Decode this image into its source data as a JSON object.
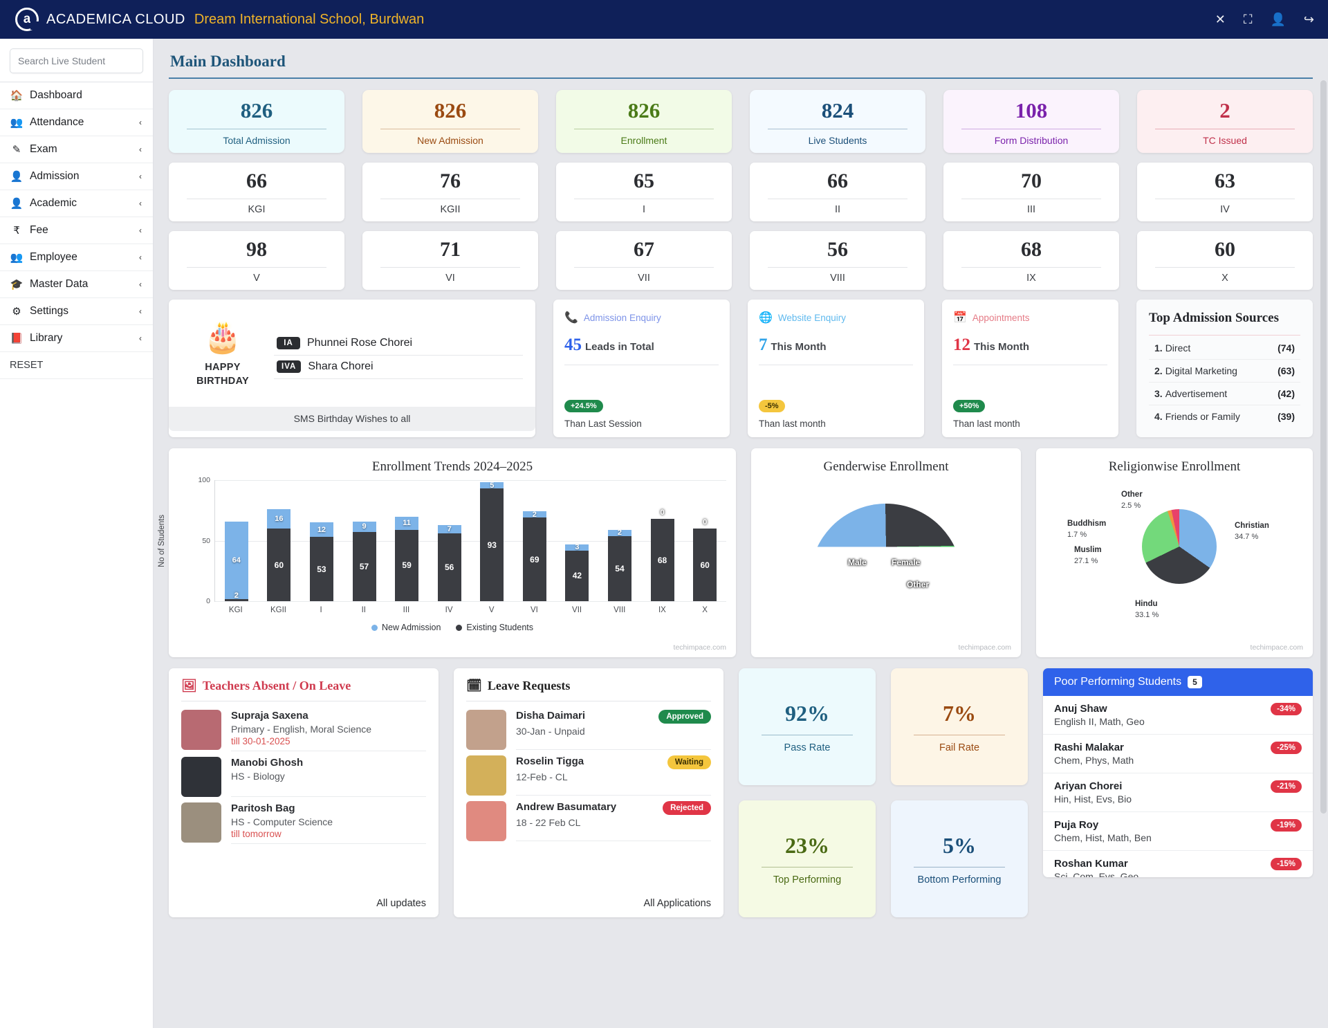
{
  "topbar": {
    "brand": "ACADEMICA CLOUD",
    "school": "Dream International School, Burdwan",
    "close_icon": "✕",
    "expand_icon": "⛶",
    "user_icon": "👤",
    "logout_icon": "↪"
  },
  "sidebar": {
    "search_placeholder": "Search Live Student",
    "items": [
      {
        "label": "Dashboard",
        "icon": "🏠",
        "chevron": ""
      },
      {
        "label": "Attendance",
        "icon": "👥",
        "chevron": "‹"
      },
      {
        "label": "Exam",
        "icon": "✎",
        "chevron": "‹"
      },
      {
        "label": "Admission",
        "icon": "👤",
        "chevron": "‹"
      },
      {
        "label": "Academic",
        "icon": "👤",
        "chevron": "‹"
      },
      {
        "label": "Fee",
        "icon": "₹",
        "chevron": "‹"
      },
      {
        "label": "Employee",
        "icon": "👥",
        "chevron": "‹"
      },
      {
        "label": "Master Data",
        "icon": "🎓",
        "chevron": "‹"
      },
      {
        "label": "Settings",
        "icon": "⚙",
        "chevron": "‹"
      },
      {
        "label": "Library",
        "icon": "📕",
        "chevron": "‹"
      }
    ],
    "reset": "RESET"
  },
  "page": {
    "title": "Main Dashboard"
  },
  "kpis": [
    {
      "value": "826",
      "label": "Total Admission",
      "color": "#1f5f80",
      "bg": "#ecfbfd"
    },
    {
      "value": "826",
      "label": "New Admission",
      "color": "#9a4a11",
      "bg": "#fdf7e8"
    },
    {
      "value": "826",
      "label": "Enrollment",
      "color": "#4a7a17",
      "bg": "#f2fbe7"
    },
    {
      "value": "824",
      "label": "Live Students",
      "color": "#1b4f79",
      "bg": "#f4faff"
    },
    {
      "value": "108",
      "label": "Form Distribution",
      "color": "#7a22ab",
      "bg": "#fbf3fd"
    },
    {
      "value": "2",
      "label": "TC Issued",
      "color": "#c0304a",
      "bg": "#fdeff1"
    }
  ],
  "classes": [
    {
      "value": "66",
      "label": "KGI"
    },
    {
      "value": "76",
      "label": "KGII"
    },
    {
      "value": "65",
      "label": "I"
    },
    {
      "value": "66",
      "label": "II"
    },
    {
      "value": "70",
      "label": "III"
    },
    {
      "value": "63",
      "label": "IV"
    },
    {
      "value": "98",
      "label": "V"
    },
    {
      "value": "71",
      "label": "VI"
    },
    {
      "value": "67",
      "label": "VII"
    },
    {
      "value": "56",
      "label": "VIII"
    },
    {
      "value": "68",
      "label": "IX"
    },
    {
      "value": "60",
      "label": "X"
    }
  ],
  "birthday": {
    "cake_icon": "🎂",
    "title": "HAPPY BIRTHDAY",
    "people": [
      {
        "class": "IA",
        "name": "Phunnei Rose Chorei"
      },
      {
        "class": "IVA",
        "name": "Shara Chorei"
      }
    ],
    "footer": "SMS Birthday Wishes to all"
  },
  "enquiries": [
    {
      "icon": "📞",
      "title": "Admission Enquiry",
      "title_color": "#7d93e8",
      "number": "45",
      "number_color": "#2f62ea",
      "text": "Leads in Total",
      "badge": "+24.5%",
      "badge_color": "#1f8a4c",
      "badge_text_color": "#ffffff",
      "sub": "Than Last Session"
    },
    {
      "icon": "🌐",
      "title": "Website Enquiry",
      "title_color": "#5fb9ee",
      "number": "7",
      "number_color": "#2fa3e8",
      "text": "This Month",
      "badge": "-5%",
      "badge_color": "#f4c63d",
      "badge_text_color": "#3a2f00",
      "sub": "Than last month"
    },
    {
      "icon": "📅",
      "title": "Appointments",
      "title_color": "#e57b86",
      "number": "12",
      "number_color": "#e03546",
      "text": "This Month",
      "badge": "+50%",
      "badge_color": "#1f8a4c",
      "badge_text_color": "#ffffff",
      "sub": "Than last month"
    }
  ],
  "sources": {
    "title": "Top Admission Sources",
    "rows": [
      {
        "n": "1.",
        "label": "Direct",
        "count": "(74)"
      },
      {
        "n": "2.",
        "label": "Digital Marketing",
        "count": "(63)"
      },
      {
        "n": "3.",
        "label": "Advertisement",
        "count": "(42)"
      },
      {
        "n": "4.",
        "label": "Friends or Family",
        "count": "(39)"
      }
    ]
  },
  "chart_data": [
    {
      "type": "bar",
      "title": "Enrollment Trends 2024–2025",
      "xlabel": "",
      "ylabel": "No of Students",
      "ylim": [
        0,
        100
      ],
      "yticks": [
        0,
        50,
        100
      ],
      "grid": true,
      "stacked": true,
      "legend_position": "bottom",
      "watermark": "techimpace.com",
      "categories": [
        "KGI",
        "KGII",
        "I",
        "II",
        "III",
        "IV",
        "V",
        "VI",
        "VII",
        "VIII",
        "IX",
        "X"
      ],
      "series": [
        {
          "name": "New Admission",
          "color": "#7cb3e8",
          "values": [
            64,
            16,
            12,
            9,
            11,
            7,
            5,
            2,
            3,
            2,
            0,
            0
          ]
        },
        {
          "name": "Existing Students",
          "color": "#3b3d42",
          "values": [
            2,
            60,
            53,
            57,
            59,
            56,
            93,
            69,
            42,
            54,
            68,
            60
          ]
        }
      ]
    },
    {
      "type": "pie",
      "variant": "semi-donut",
      "title": "Genderwise Enrollment",
      "watermark": "techimpace.com",
      "labels": [
        "Male",
        "Female",
        "Other"
      ],
      "colors": [
        "#7cb3e8",
        "#3b3d42",
        "#4cc764"
      ],
      "values": [
        49.5,
        50.0,
        0.5
      ]
    },
    {
      "type": "pie",
      "title": "Religionwise Enrollment",
      "watermark": "techimpace.com",
      "labels": [
        "Christian",
        "Hindu",
        "Muslim",
        "Buddhism",
        "Other"
      ],
      "values": [
        34.7,
        33.1,
        27.1,
        1.7,
        2.5
      ],
      "value_labels": [
        "34.7 %",
        "33.1 %",
        "27.1 %",
        "1.7 %",
        "2.5 %"
      ],
      "colors": [
        "#7cb3e8",
        "#3b3d42",
        "#73d97b",
        "#f09440",
        "#e8416a"
      ]
    }
  ],
  "teachers_absent": {
    "title": "Teachers Absent / On Leave",
    "icon": "🖼",
    "rows": [
      {
        "name": "Supraja Saxena",
        "sub": "Primary - English, Moral Science",
        "till": "till 30-01-2025",
        "avatar": "#b86a72"
      },
      {
        "name": "Manobi Ghosh",
        "sub": "HS - Biology",
        "till": "",
        "avatar": "#2f3238"
      },
      {
        "name": "Paritosh Bag",
        "sub": "HS - Computer Science",
        "till": "till tomorrow",
        "avatar": "#9b8f7e"
      }
    ],
    "footer": "All updates"
  },
  "leave_requests": {
    "title": "Leave Requests",
    "icon": "🗓",
    "rows": [
      {
        "name": "Disha Daimari",
        "sub": "30-Jan - Unpaid",
        "status": "Approved",
        "status_color": "#1f8a4c",
        "avatar": "#c2a18c"
      },
      {
        "name": "Roselin Tigga",
        "sub": "12-Feb - CL",
        "status": "Waiting",
        "status_color": "#f4c63d",
        "avatar": "#d3b05a"
      },
      {
        "name": "Andrew Basumatary",
        "sub": "18 - 22 Feb CL",
        "status": "Rejected",
        "status_color": "#e03546",
        "avatar": "#e08a80"
      }
    ],
    "footer": "All Applications"
  },
  "rates": [
    {
      "value": "92%",
      "label": "Pass Rate",
      "color": "#1f5f80",
      "bg": "#edfafd"
    },
    {
      "value": "7%",
      "label": "Fail Rate",
      "color": "#9a4a11",
      "bg": "#fdf5e6"
    },
    {
      "value": "23%",
      "label": "Top Performing",
      "color": "#4a6a14",
      "bg": "#f5fae4"
    },
    {
      "value": "5%",
      "label": "Bottom Performing",
      "color": "#1b4f79",
      "bg": "#eef5fd"
    }
  ],
  "poor_performing": {
    "title": "Poor Performing Students",
    "count": "5",
    "rows": [
      {
        "name": "Anuj Shaw",
        "subjects": "English II, Math, Geo",
        "delta": "-34%"
      },
      {
        "name": "Rashi Malakar",
        "subjects": "Chem, Phys, Math",
        "delta": "-25%"
      },
      {
        "name": "Ariyan Chorei",
        "subjects": "Hin, Hist, Evs, Bio",
        "delta": "-21%"
      },
      {
        "name": "Puja Roy",
        "subjects": "Chem, Hist, Math, Ben",
        "delta": "-19%"
      },
      {
        "name": "Roshan Kumar",
        "subjects": "Sci, Com, Evs, Geo",
        "delta": "-15%"
      }
    ]
  }
}
